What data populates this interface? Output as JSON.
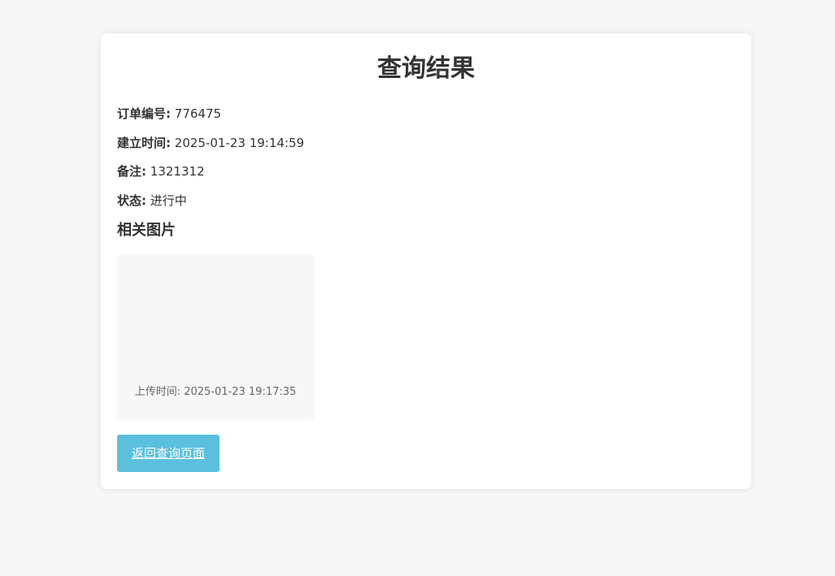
{
  "page": {
    "title": "查询结果"
  },
  "order": {
    "number_label": "订单编号:",
    "number_value": "776475",
    "created_label": "建立时间:",
    "created_value": "2025-01-23 19:14:59",
    "note_label": "备注:",
    "note_value": "1321312",
    "status_label": "状态:",
    "status_value": "进行中"
  },
  "images": {
    "section_title": "相关图片",
    "items": [
      {
        "upload_time": "上传时间: 2025-01-23 19:17:35"
      }
    ]
  },
  "actions": {
    "back_label": "返回查询页面"
  },
  "colors": {
    "page_bg": "#f6f6f6",
    "card_bg": "#ffffff",
    "button_bg": "#5bc0de",
    "text": "#333333"
  }
}
